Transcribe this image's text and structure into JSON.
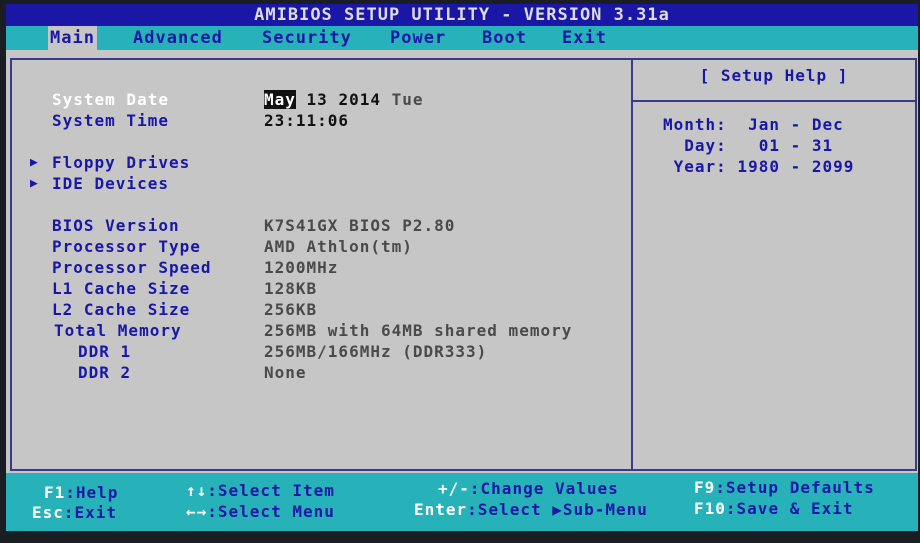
{
  "title": "AMIBIOS SETUP UTILITY - VERSION 3.31a",
  "tabs": [
    {
      "label": "Main"
    },
    {
      "label": "Advanced"
    },
    {
      "label": "Security"
    },
    {
      "label": "Power"
    },
    {
      "label": "Boot"
    },
    {
      "label": "Exit"
    }
  ],
  "main": {
    "system_date": {
      "label": "System Date",
      "month": "May",
      "rest": " 13 2014",
      "day": "Tue"
    },
    "system_time": {
      "label": "System Time",
      "value": "23:11:06"
    },
    "submenus": [
      {
        "label": "Floppy Drives"
      },
      {
        "label": "IDE Devices"
      }
    ],
    "info": [
      {
        "label": "BIOS Version",
        "value": "K7S41GX BIOS P2.80"
      },
      {
        "label": "Processor Type",
        "value": "AMD Athlon(tm)"
      },
      {
        "label": "Processor Speed",
        "value": "1200MHz"
      },
      {
        "label": "L1 Cache Size",
        "value": "128KB"
      },
      {
        "label": "L2 Cache Size",
        "value": "256KB"
      },
      {
        "label": "Total Memory",
        "value": "256MB with 64MB shared memory"
      },
      {
        "label": "DDR 1",
        "value": "256MB/166MHz (DDR333)"
      },
      {
        "label": "DDR 2",
        "value": "None"
      }
    ]
  },
  "help": {
    "title": "[  Setup Help  ]",
    "lines": [
      "Month:  Jan - Dec",
      "  Day:   01 - 31",
      " Year: 1980 - 2099"
    ]
  },
  "footer": {
    "f1": {
      "key": "F1",
      "text": ":Help"
    },
    "esc": {
      "key": "Esc",
      "text": ":Exit"
    },
    "select_item": {
      "key": "↑↓",
      "text": ":Select Item"
    },
    "select_menu": {
      "key": "←→",
      "text": ":Select Menu"
    },
    "change_values": {
      "key": "+/-",
      "text": ":Change Values"
    },
    "select_submenu": {
      "key": "Enter",
      "text": ":Select ▶Sub-Menu"
    },
    "f9": {
      "key": "F9",
      "text": ":Setup Defaults"
    },
    "f10": {
      "key": "F10",
      "text": ":Save & Exit"
    }
  },
  "colors": {
    "bios_blue": "#1a17a6",
    "cyan": "#27b1b9",
    "grey": "#c6c6c6"
  }
}
